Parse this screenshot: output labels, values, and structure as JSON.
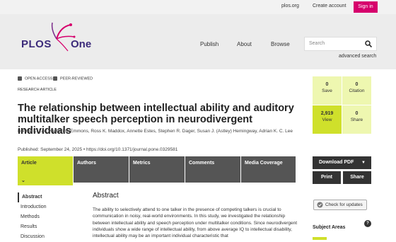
{
  "topbar": {
    "plos_org": "plos.org",
    "create_account": "Create account",
    "sign_in": "Sign in"
  },
  "header": {
    "logo_plos": "PLOS",
    "logo_one": "One",
    "nav": [
      "Publish",
      "About",
      "Browse"
    ],
    "search_placeholder": "Search",
    "advanced_search": "advanced search"
  },
  "article": {
    "badges": [
      "OPEN ACCESS",
      "PEER-REVIEWED"
    ],
    "type": "RESEARCH ARTICLE",
    "title": "The relationship between intellectual ability and auditory multitalker speech perception in neurodivergent individuals",
    "authors": "Bonnie K. Lau, Katherine Emmons, Ross K. Maddox, Annette Estes, Stephen R. Dager, Susan J. (Astley) Hemingway, Adrian K. C. Lee",
    "published": "Published: September 24, 2025",
    "doi": "https://doi.org/10.1371/journal.pone.0329581"
  },
  "tabs": [
    "Article",
    "Authors",
    "Metrics",
    "Comments",
    "Media Coverage"
  ],
  "toc": [
    "Abstract",
    "Introduction",
    "Methods",
    "Results",
    "Discussion"
  ],
  "abstract": {
    "heading": "Abstract",
    "text": "The ability to selectively attend to one talker in the presence of competing talkers is crucial to communication in noisy, real-world environments. In this study, we investigated the relationship between intellectual ability and speech perception under multitalker conditions. Since neurodivergent individuals show a wide range of intellectual ability, from above average IQ to intellectual disability, intellectual ability may be an important individual characteristic that"
  },
  "metrics": [
    {
      "value": "0",
      "label": "Save"
    },
    {
      "value": "0",
      "label": "Citation"
    },
    {
      "value": "2,919",
      "label": "View"
    },
    {
      "value": "0",
      "label": "Share"
    }
  ],
  "actions": {
    "download": "Download PDF",
    "print": "Print",
    "share": "Share",
    "check_updates": "Check for updates"
  },
  "subject_areas": "Subject Areas",
  "colors": {
    "accent": "#cfe02b",
    "accent_light": "#eef7b0",
    "brand": "#d6006c",
    "dark": "#333333"
  }
}
